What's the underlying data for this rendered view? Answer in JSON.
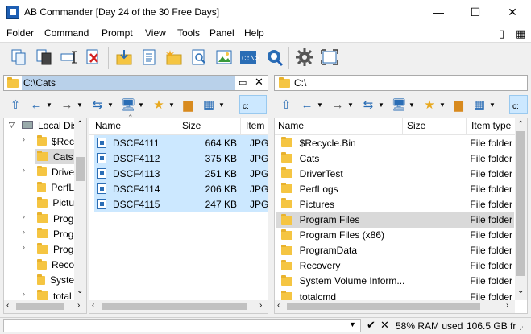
{
  "window": {
    "title": "AB Commander [Day 24 of the 30 Free Days]",
    "minimize_glyph": "—",
    "maximize_glyph": "☐",
    "close_glyph": "✕"
  },
  "menu": {
    "items": [
      "Folder",
      "Command",
      "Prompt",
      "View",
      "Tools",
      "Panel",
      "Help"
    ],
    "right_icons": [
      "▯",
      "▦"
    ]
  },
  "toolbar": {
    "icons": [
      "copy-icon",
      "move-icon",
      "rename-icon",
      "delete-icon",
      "compress-icon",
      "properties-icon",
      "new-folder-icon",
      "find-icon",
      "image-viewer-icon",
      "command-prompt-icon",
      "search-disk-icon",
      "settings-icon",
      "fullscreen-icon"
    ]
  },
  "left_panel": {
    "path": "C:\\Cats",
    "drive_label": "c:",
    "tree": {
      "root_label": "Local Dis",
      "items": [
        "$Rec",
        "Cats",
        "Drive",
        "PerfL",
        "Pictu",
        "Prog",
        "Prog",
        "Prog",
        "Reco",
        "Syste",
        "total"
      ]
    },
    "columns": [
      "Name",
      "Size",
      "Item"
    ],
    "files": [
      {
        "name": "DSCF4111",
        "size": "664 KB",
        "type": "JPG F"
      },
      {
        "name": "DSCF4112",
        "size": "375 KB",
        "type": "JPG F"
      },
      {
        "name": "DSCF4113",
        "size": "251 KB",
        "type": "JPG F"
      },
      {
        "name": "DSCF4114",
        "size": "206 KB",
        "type": "JPG F"
      },
      {
        "name": "DSCF4115",
        "size": "247 KB",
        "type": "JPG F"
      }
    ]
  },
  "right_panel": {
    "path": "C:\\",
    "drive_label": "c:",
    "columns": [
      "Name",
      "Size",
      "Item type"
    ],
    "files": [
      {
        "name": "$Recycle.Bin",
        "type": "File folder"
      },
      {
        "name": "Cats",
        "type": "File folder"
      },
      {
        "name": "DriverTest",
        "type": "File folder"
      },
      {
        "name": "PerfLogs",
        "type": "File folder"
      },
      {
        "name": "Pictures",
        "type": "File folder"
      },
      {
        "name": "Program Files",
        "type": "File folder"
      },
      {
        "name": "Program Files (x86)",
        "type": "File folder"
      },
      {
        "name": "ProgramData",
        "type": "File folder"
      },
      {
        "name": "Recovery",
        "type": "File folder"
      },
      {
        "name": "System Volume Inform...",
        "type": "File folder"
      },
      {
        "name": "totalcmd",
        "type": "File folder"
      }
    ]
  },
  "status": {
    "ram": "58% RAM used",
    "free": "106.5 GB fr"
  },
  "colors": {
    "selection": "#cce8ff",
    "active_path": "#b9d1ea",
    "folder": "#f5c542"
  }
}
